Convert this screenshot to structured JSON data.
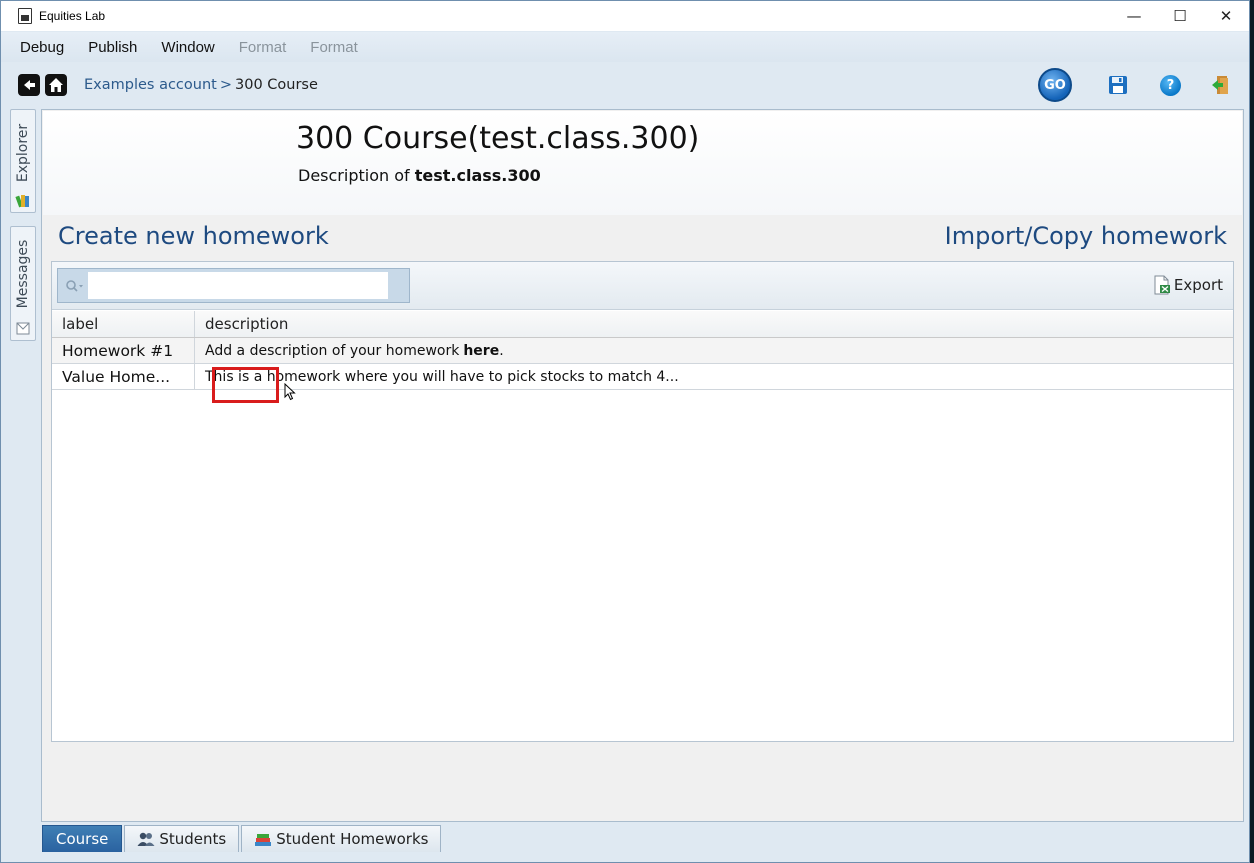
{
  "window": {
    "title": "Equities Lab",
    "controls": {
      "minimize": "—",
      "maximize": "☐",
      "close": "✕"
    }
  },
  "menu": {
    "items": [
      {
        "label": "Debug",
        "enabled": true
      },
      {
        "label": "Publish",
        "enabled": true
      },
      {
        "label": "Window",
        "enabled": true
      },
      {
        "label": "Format",
        "enabled": false
      },
      {
        "label": "Format",
        "enabled": false
      }
    ]
  },
  "toolbar": {
    "breadcrumb": {
      "link": "Examples account",
      "separator": ">",
      "current": "300 Course"
    },
    "go_label": "GO",
    "help_label": "?"
  },
  "side_tabs": {
    "explorer": "Explorer",
    "messages": "Messages"
  },
  "course": {
    "title": "300 Course(test.class.300)",
    "description_prefix": "Description of",
    "description_name": "test.class.300"
  },
  "actions": {
    "create": "Create new homework",
    "import": "Import/Copy homework"
  },
  "list": {
    "search_placeholder": "",
    "search_value": "",
    "export_label": "Export",
    "columns": [
      "label",
      "description"
    ],
    "rows": [
      {
        "label": "Homework #1",
        "description": "Add a description of your homework",
        "description_bold": "here",
        "description_suffix": "."
      },
      {
        "label": "Value Home...",
        "description": "This is a homework where you will have to pick stocks to match 4...",
        "description_bold": "",
        "description_suffix": ""
      }
    ]
  },
  "bottom_tabs": [
    {
      "label": "Course",
      "active": true
    },
    {
      "label": "Students",
      "active": false
    },
    {
      "label": "Student Homeworks",
      "active": false
    }
  ],
  "colors": {
    "accent": "#1e4a80",
    "active_tab": "#2a62a0",
    "highlight": "#d91c1c"
  }
}
